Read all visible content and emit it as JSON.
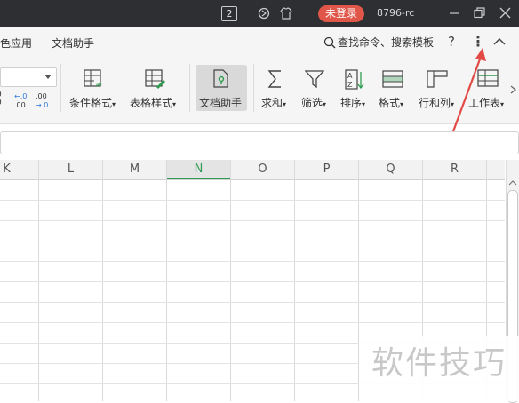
{
  "titlebar": {
    "tab_count": "2",
    "login": "未登录",
    "user": "8796-rc"
  },
  "menu": {
    "items": [
      "色应用",
      "文档助手"
    ],
    "search": "查找命令、搜索模板",
    "help": "?",
    "more": "⋮"
  },
  "ribbon": {
    "conditional_format": "条件格式",
    "table_style": "表格样式",
    "doc_assistant": "文档助手",
    "sum": "求和",
    "filter": "筛选",
    "sort": "排序",
    "format": "格式",
    "rowcol": "行和列",
    "worksheet": "工作表"
  },
  "grid": {
    "columns": [
      "K",
      "L",
      "M",
      "N",
      "O",
      "P",
      "Q",
      "R"
    ],
    "selected_column": "N"
  },
  "watermark": "软件技巧",
  "colors": {
    "titlebar": "#2d2f33",
    "login": "#e0574a",
    "accent": "#2e9d4f",
    "arrow": "#e24b45"
  }
}
